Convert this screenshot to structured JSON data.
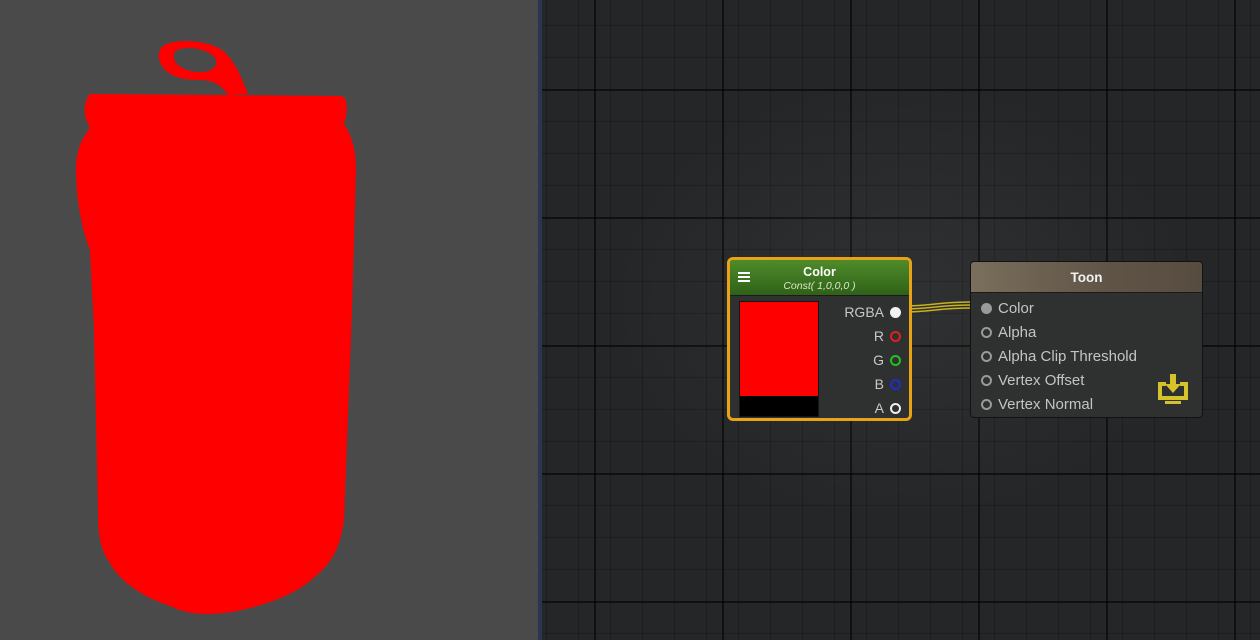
{
  "preview": {
    "background": "#4a4a4a",
    "object": "soda-can",
    "object_color": "#ff0000"
  },
  "color_node": {
    "title": "Color",
    "subtitle": "Const( 1,0,0,0 )",
    "header_color": "#3f7a22",
    "border_color": "#e8a316",
    "swatch_color": "#ff0000",
    "swatch_alpha_color": "#000000",
    "ports": [
      {
        "label": "RGBA",
        "color": "#f2f2f2"
      },
      {
        "label": "R",
        "color": "#e02020"
      },
      {
        "label": "G",
        "color": "#22c022"
      },
      {
        "label": "B",
        "color": "#1a2fd0"
      },
      {
        "label": "A",
        "color": "#eeeeee"
      }
    ]
  },
  "toon_node": {
    "title": "Toon",
    "inputs": [
      {
        "label": "Color"
      },
      {
        "label": "Alpha"
      },
      {
        "label": "Alpha Clip Threshold"
      },
      {
        "label": "Vertex Offset"
      },
      {
        "label": "Vertex Normal"
      }
    ],
    "output_icon": "output-download-icon"
  },
  "wire_color": "#c9b21a"
}
